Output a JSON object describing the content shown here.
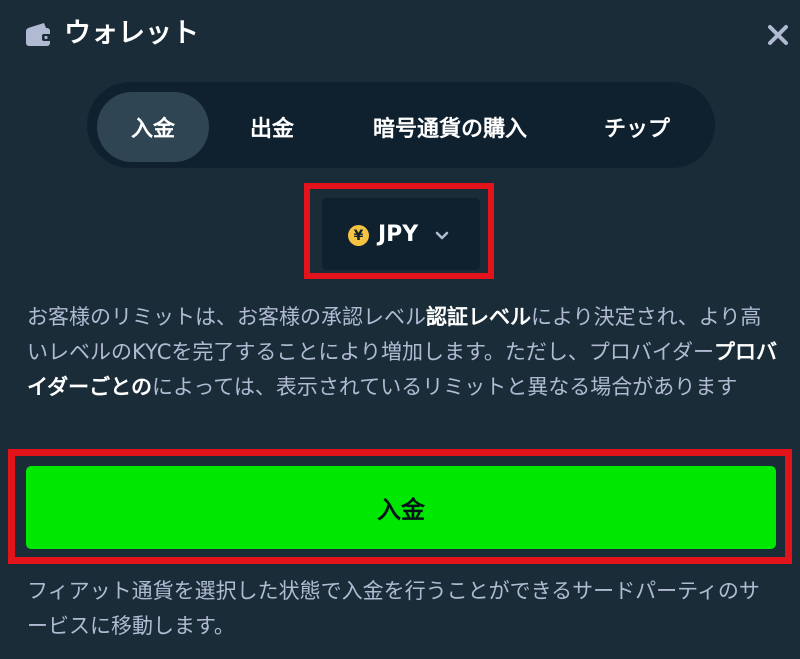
{
  "header": {
    "title": "ウォレット",
    "icon": "wallet-icon",
    "close_icon": "close-icon"
  },
  "tabs": [
    {
      "label": "入金",
      "active": true
    },
    {
      "label": "出金",
      "active": false
    },
    {
      "label": "暗号通貨の購入",
      "active": false
    },
    {
      "label": "チップ",
      "active": false
    }
  ],
  "currency": {
    "code": "JPY",
    "symbol": "¥",
    "icon": "yen-coin-icon"
  },
  "info": {
    "part1": "お客様のリミットは、お客様の承認レベル",
    "bold1": "認証レベル",
    "part2": "により決定され、より高いレベルのKYCを完了することにより増加します。ただし、プロバイダー",
    "bold2": "プロバイダーごとの",
    "part3": "によっては、表示されているリミットと異なる場合があります"
  },
  "deposit_button": {
    "label": "入金"
  },
  "footnote": "フィアット通貨を選択した状態で入金を行うことができるサードパーティのサービスに移動します。",
  "colors": {
    "background": "#1a2c38",
    "panel": "#0f212e",
    "active_tab": "#2f4553",
    "button_green": "#00e701",
    "highlight_red": "#e3131b",
    "text_muted": "#b1bad3"
  }
}
